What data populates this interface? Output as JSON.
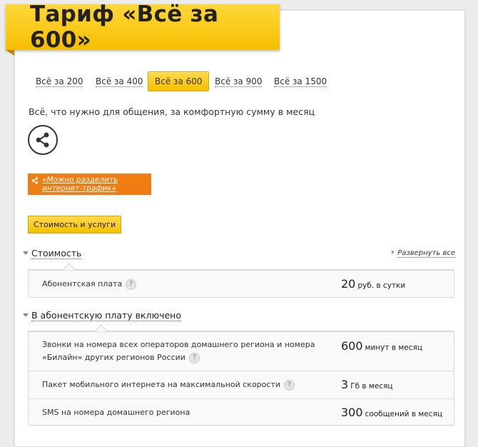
{
  "title": "Тариф «Всё за 600»",
  "tabs": [
    {
      "label": "Всё за 200",
      "active": false
    },
    {
      "label": "Всё за 400",
      "active": false
    },
    {
      "label": "Всё за 600",
      "active": true
    },
    {
      "label": "Всё за 900",
      "active": false
    },
    {
      "label": "Всё за 1500",
      "active": false
    }
  ],
  "subtitle": "Всё, что нужно для общения, за комфортную сумму в месяц",
  "share_icon": "share-icon",
  "promo": {
    "line1": "«Можно разделить",
    "line2": "интернет-трафик»"
  },
  "cost_tab_label": "Стоимость и услуги",
  "cost_section": {
    "heading": "Стоимость",
    "expand_label": "Развернуть все",
    "rows": [
      {
        "name": "Абонентская плата",
        "value": "20",
        "unit": "руб. в сутки"
      }
    ]
  },
  "included_section": {
    "heading": "В абонентскую плату включено",
    "rows": [
      {
        "name_line1": "Звонки на номера всех операторов домашнего региона и номера",
        "name_line2": "«Билайн» других регионов России",
        "value": "600",
        "unit": "минут в месяц"
      },
      {
        "name": "Пакет мобильного интернета на максимальной скорости",
        "value": "3",
        "unit": "Гб в месяц"
      },
      {
        "name": "SMS на номера домашнего региона",
        "value": "300",
        "unit": "сообщений в месяц"
      }
    ]
  },
  "help_glyph": "?",
  "colors": {
    "brand_yellow": "#f6be00",
    "promo_orange": "#f07d13"
  }
}
